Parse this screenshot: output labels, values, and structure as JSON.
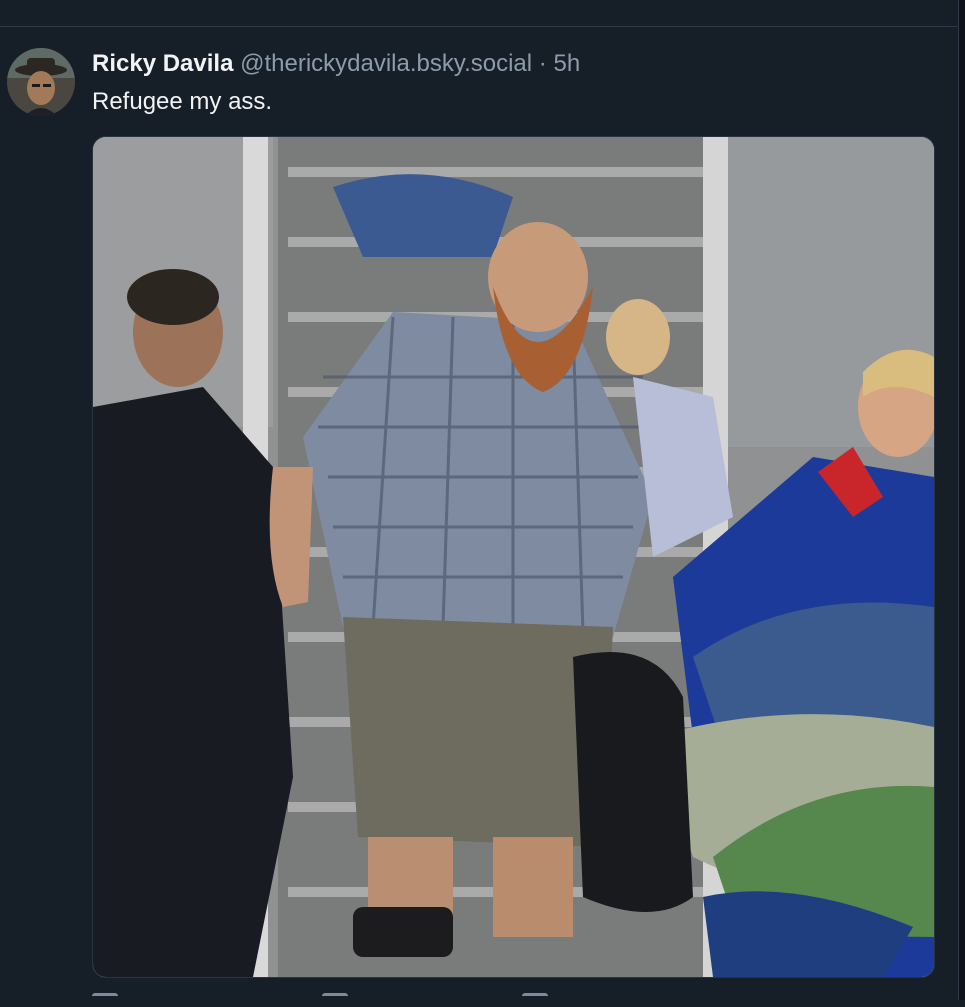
{
  "post": {
    "display_name": "Ricky Davila",
    "handle": "@therickydavila.bsky.social",
    "separator": "·",
    "time": "5h",
    "text": "Refugee my ass."
  },
  "icons": {
    "avatar": "user-avatar",
    "reply": "reply-icon",
    "repost": "repost-icon",
    "like": "heart-icon"
  },
  "colors": {
    "background": "#161e27",
    "text_primary": "#f1f3f5",
    "text_secondary": "#8d9bab"
  }
}
